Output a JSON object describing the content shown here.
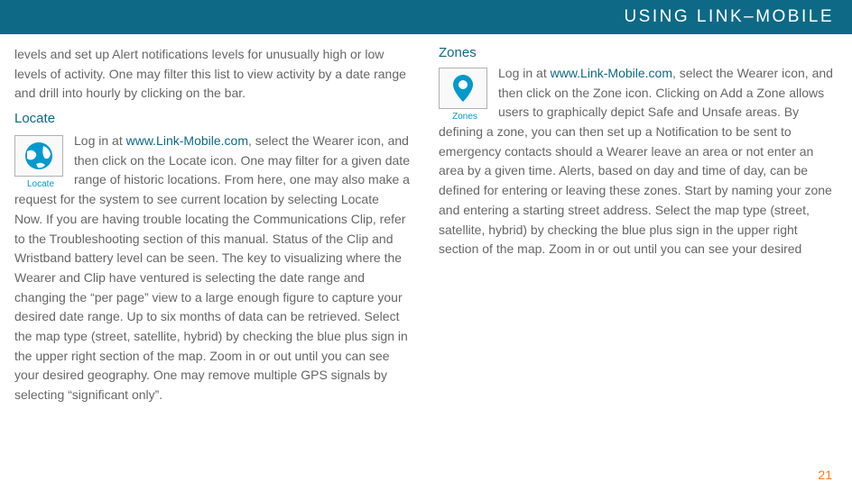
{
  "header": {
    "title": "USING LINK–MOBILE"
  },
  "link_text": "www.Link-Mobile.com",
  "left": {
    "intro": "levels and set up Alert notifications levels for unusually high or low levels of activity. One may filter this list to view activity by a date range and drill into hourly by clicking on the bar.",
    "locate_heading": "Locate",
    "locate_icon_label": "Locate",
    "locate_pretext": "Log in at ",
    "locate_posttext": ", select the Wearer icon, and then click on the Locate icon. One may filter for a given date range of historic locations. From here, one may also make a request for the system to see current location by selecting Locate Now. If you are having trouble locating the Communications Clip, refer to the Troubleshooting section of this manual. Status of the Clip and Wristband battery level can be seen. The key to visualizing where the Wearer and Clip have ventured is selecting the date range and changing the “per page” view to a large enough figure to capture your desired date range.  Up to six months of data can be retrieved. Select the map type (street, satellite, hybrid) by checking the blue plus sign in the upper right section of the map. Zoom in or out until you can see your desired geography. One may remove multiple GPS signals by selecting “significant only”."
  },
  "right": {
    "zones_heading": "Zones",
    "zones_icon_label": "Zones",
    "zones_pretext": "Log in at ",
    "zones_posttext": ", select the Wearer icon, and then click on the Zone icon. Clicking on Add a Zone allows users to graphically depict Safe and Unsafe areas. By defining a zone, you can then set up a Notification to be sent to emergency contacts should a Wearer leave an area or not enter an area by a given time. Alerts, based on day and time of day, can be defined for entering or leaving these zones. Start by naming your zone and entering a starting street address. Select the map type (street, satellite, hybrid) by checking the blue plus sign in the upper right section of the map. Zoom in or out until you can see your desired"
  },
  "page_number": "21"
}
